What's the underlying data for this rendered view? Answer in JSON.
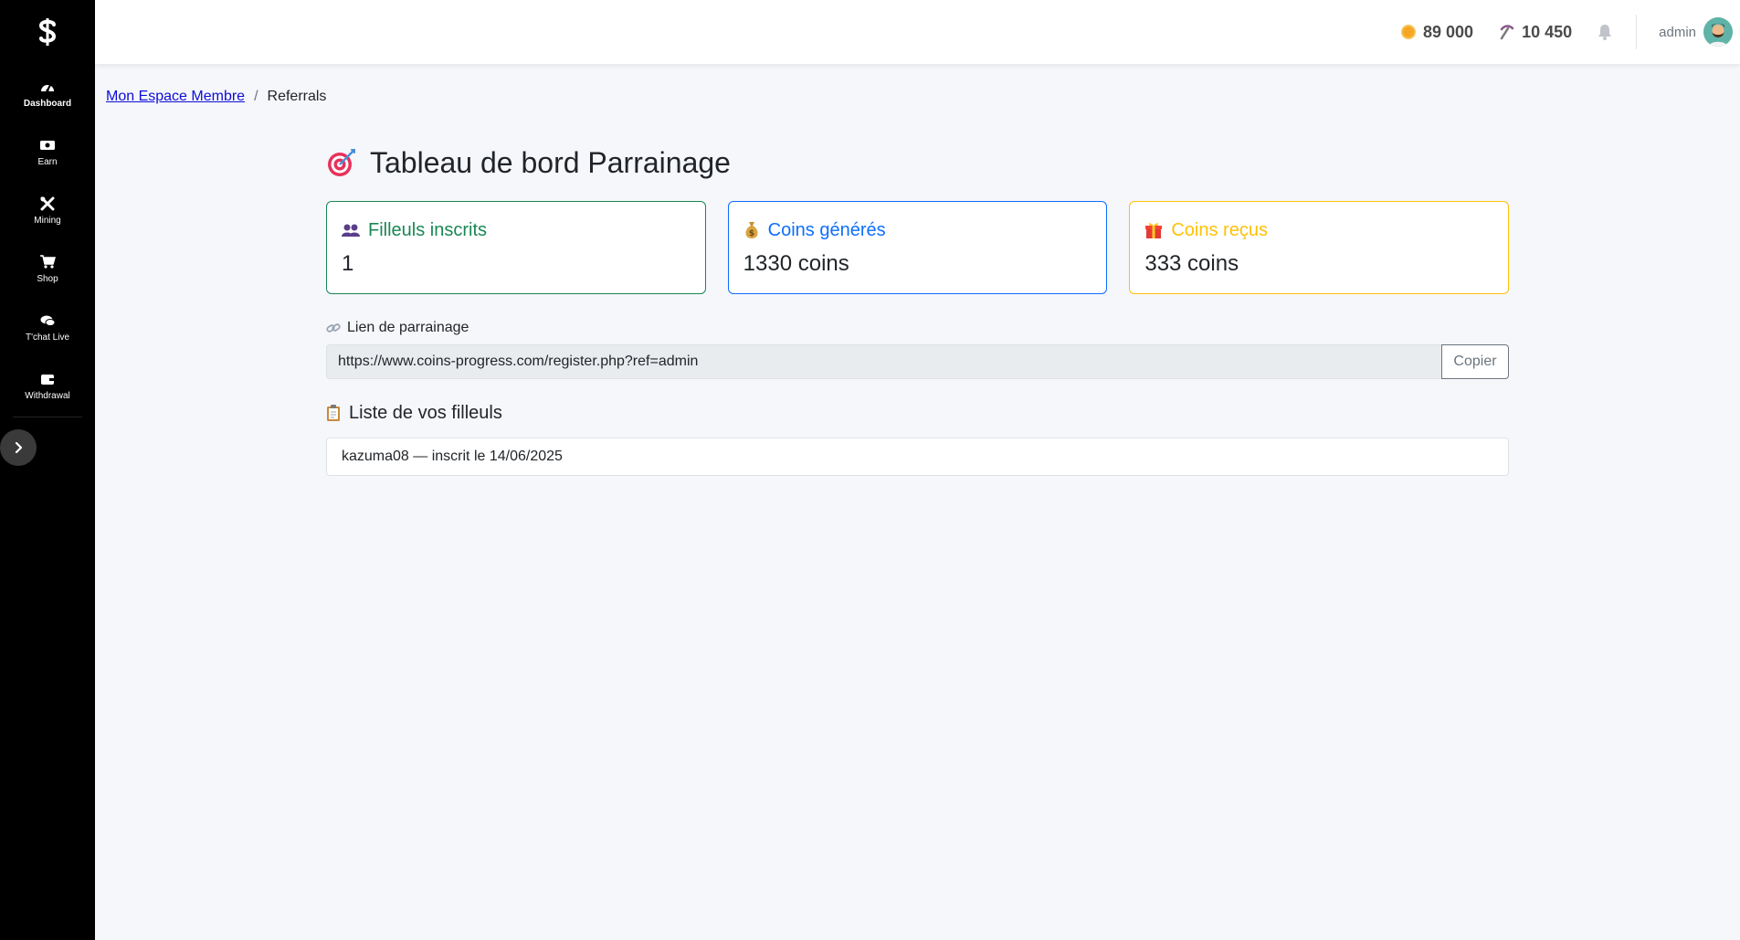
{
  "colors": {
    "sidebar_bg": "#000000",
    "green": "#198754",
    "blue": "#0d6efd",
    "yellow": "#ffc107",
    "link": "#0d0dd6"
  },
  "sidebar": {
    "logo_icon": "dollar-icon",
    "items": [
      {
        "label": "Dashboard",
        "icon": "gauge-icon"
      },
      {
        "label": "Earn",
        "icon": "money-icon"
      },
      {
        "label": "Mining",
        "icon": "tools-icon"
      },
      {
        "label": "Shop",
        "icon": "cart-icon"
      },
      {
        "label": "T'chat Live",
        "icon": "chat-icon"
      },
      {
        "label": "Withdrawal",
        "icon": "wallet-icon"
      }
    ],
    "toggle_icon": "chevron-right-icon"
  },
  "topbar": {
    "coins": "89 000",
    "mining": "10 450",
    "username": "admin"
  },
  "breadcrumb": {
    "home": "Mon Espace Membre",
    "separator": "/",
    "current": "Referrals"
  },
  "page": {
    "title": "Tableau de bord Parrainage",
    "cards": [
      {
        "title": "Filleuls inscrits",
        "value": "1",
        "icon": "users-icon"
      },
      {
        "title": "Coins générés",
        "value": "1330 coins",
        "icon": "money-bag-icon"
      },
      {
        "title": "Coins reçus",
        "value": "333 coins",
        "icon": "gift-icon"
      }
    ],
    "link_label": "Lien de parrainage",
    "referral_link": "https://www.coins-progress.com/register.php?ref=admin",
    "copy_label": "Copier",
    "list_title": "Liste de vos filleuls",
    "referrals": [
      {
        "text": "kazuma08 — inscrit le 14/06/2025"
      }
    ]
  }
}
